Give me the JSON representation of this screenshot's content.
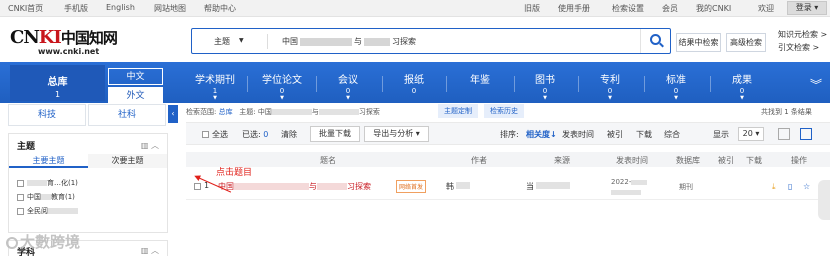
{
  "topbar": {
    "left": [
      "CNKI首页",
      "手机版",
      "English",
      "网站地图",
      "帮助中心"
    ],
    "right": [
      "旧版",
      "使用手册",
      "检索设置",
      "会员",
      "我的CNKI",
      "欢迎"
    ],
    "login": "登录 ▾"
  },
  "logo": {
    "text_prefix": "CN",
    "text_ki": "KI",
    "text_cn": "中国知网",
    "url": "www.cnki.net"
  },
  "search": {
    "field": "主题",
    "query_prefix": "中国",
    "query_mid": "与",
    "query_suffix": "习探索",
    "button_icon": "search-icon"
  },
  "header_buttons": {
    "in_result": "结果中检索",
    "advanced": "高级检索",
    "knowledge": "知识元检索 >",
    "citation": "引文检索 >"
  },
  "nav": {
    "zongku_label": "总库",
    "zongku_count": "1",
    "lang_zh": "中文",
    "lang_wai": "外文",
    "items": [
      {
        "label": "学术期刊",
        "count": "1"
      },
      {
        "label": "学位论文",
        "count": "0"
      },
      {
        "label": "会议",
        "count": "0"
      },
      {
        "label": "报纸",
        "count": "0"
      },
      {
        "label": "年鉴",
        "count": ""
      },
      {
        "label": "图书",
        "count": "0"
      },
      {
        "label": "专利",
        "count": "0"
      },
      {
        "label": "标准",
        "count": "0"
      },
      {
        "label": "成果",
        "count": "0"
      }
    ],
    "more_icon": "double-chevron-down-icon"
  },
  "sidebar": {
    "tabs": [
      "科技",
      "社科"
    ],
    "collapse_icon": "chevron-left-icon",
    "facet_title": "主题",
    "subtabs": [
      "主要主题",
      "次要主题"
    ],
    "rows": [
      {
        "prefix": "",
        "suffix": "育…化(1)"
      },
      {
        "prefix": "中国",
        "suffix": "教育(1)"
      },
      {
        "prefix": "全民阅",
        "suffix": ""
      }
    ],
    "facet2_title": "学科"
  },
  "watermark": "大數跨境",
  "scope": {
    "label": "检索范围:",
    "value": "总库",
    "theme_label": "主题:",
    "theme_prefix": "中国",
    "theme_mid": "与",
    "theme_suffix": "习探索",
    "custom_btn": "主题定制",
    "history_btn": "检索历史",
    "found": "共找到 1 条结果"
  },
  "toolbar": {
    "select_all": "全选",
    "selected_label": "已选:",
    "selected_count": "0",
    "clear": "清除",
    "batch_download": "批量下载",
    "export": "导出与分析 ▾",
    "sort_label": "排序:",
    "sorts": [
      "相关度↓",
      "发表时间",
      "被引",
      "下载",
      "综合"
    ],
    "display_label": "显示",
    "page_size": "20 ▾"
  },
  "table": {
    "headers": [
      "题名",
      "作者",
      "来源",
      "发表时间",
      "数据库",
      "被引",
      "下载",
      "操作"
    ],
    "row": {
      "num": "1",
      "title_prefix": "中国",
      "title_mid": "与",
      "title_suffix": "习探索",
      "badge": "网络首发",
      "author_prefix": "韩",
      "source_prefix": "当",
      "date": "2022-",
      "date2": "",
      "database": "期刊"
    }
  },
  "annotation": "点击题目"
}
